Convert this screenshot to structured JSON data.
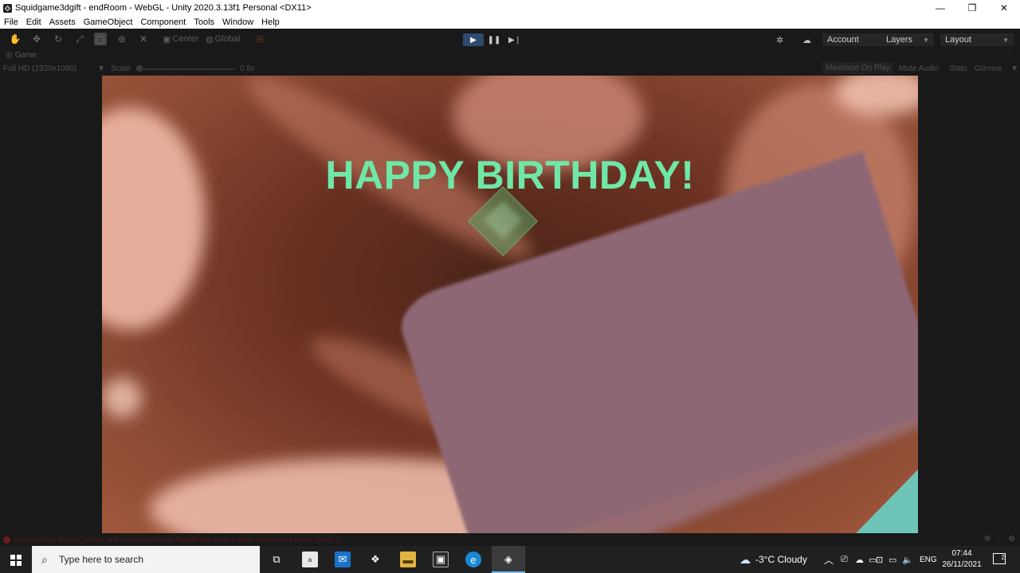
{
  "window": {
    "title": "Squidgame3dgift - endRoom - WebGL - Unity 2020.3.13f1 Personal <DX11>",
    "minimize": "—",
    "maximize": "❐",
    "close": "✕"
  },
  "menu": [
    "File",
    "Edit",
    "Assets",
    "GameObject",
    "Component",
    "Tools",
    "Window",
    "Help"
  ],
  "toolbar": {
    "pivot_center": "Center",
    "pivot_global": "Global",
    "account": "Account",
    "layers": "Layers",
    "layout": "Layout"
  },
  "game_tab": {
    "label": "Game",
    "resolution": "Full HD (1920x1080)",
    "scale_label": "Scale",
    "scale_value": "0.8x",
    "maximize_on_play": "Maximize On Play",
    "mute_audio": "Mute Audio",
    "stats": "Stats",
    "gizmos": "Gizmos"
  },
  "scene": {
    "headline": "HAPPY BIRTHDAY!",
    "headline_color": "#6ee7a7"
  },
  "status": {
    "message": "Non-convex MeshCollider with non-kinematic Rigidbody is no longer supported since Unity 5."
  },
  "taskbar": {
    "search_placeholder": "Type here to search",
    "weather": "-3°C  Cloudy",
    "language": "ENG",
    "time": "07:44",
    "date": "26/11/2021",
    "notifications": "2"
  }
}
